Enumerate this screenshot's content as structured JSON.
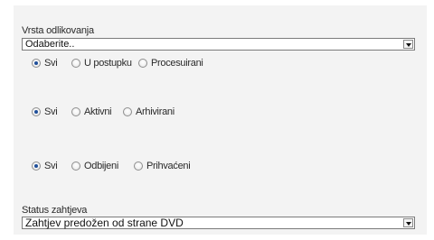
{
  "filters": {
    "vrsta_odlikovanja": {
      "label": "Vrsta odlikovanja",
      "selected": "Odaberite.."
    },
    "group1": {
      "options": [
        "Svi",
        "U postupku",
        "Procesuirani"
      ],
      "selected": "Svi"
    },
    "group2": {
      "options": [
        "Svi",
        "Aktivni",
        "Arhivirani"
      ],
      "selected": "Svi"
    },
    "group3": {
      "options": [
        "Svi",
        "Odbijeni",
        "Prihvaćeni"
      ],
      "selected": "Svi"
    },
    "status_zahtjeva": {
      "label": "Status zahtjeva",
      "selected": "Zahtjev predožen od strane DVD"
    }
  },
  "icons": {
    "dropdown": "chevron-down-icon"
  },
  "colors": {
    "panel_bg": "#f3f3f3",
    "radio_checked": "#1f4f9a"
  }
}
